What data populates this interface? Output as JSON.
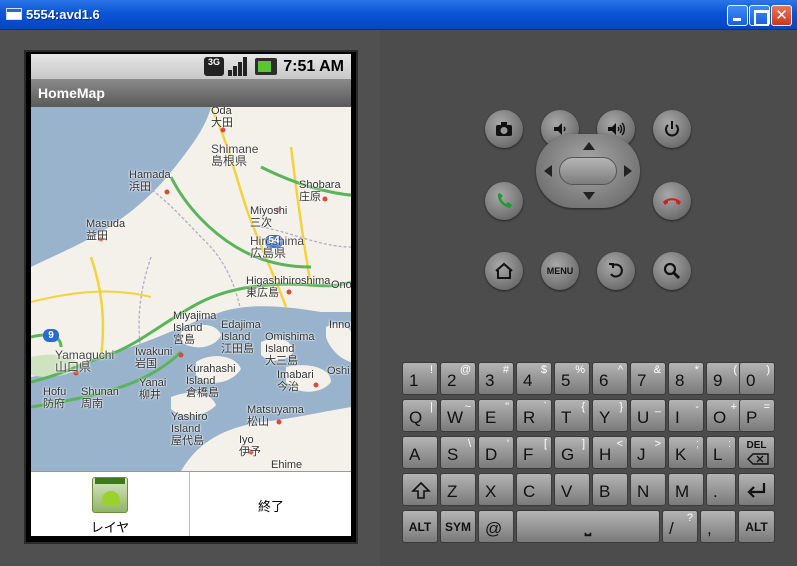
{
  "window": {
    "title": "5554:avd1.6"
  },
  "status": {
    "network": "3G",
    "time": "7:51 AM"
  },
  "app": {
    "title": "HomeMap"
  },
  "map_labels": [
    {
      "text": "Oda",
      "sub": "大田"
    },
    {
      "text": "Shimane",
      "sub": "島根県"
    },
    {
      "text": "Hamada",
      "sub": "浜田"
    },
    {
      "text": "Masuda",
      "sub": "益田"
    },
    {
      "text": "Miyoshi",
      "sub": "三次"
    },
    {
      "text": "Shobara",
      "sub": "庄原"
    },
    {
      "text": "Hiroshima",
      "sub": "広島県"
    },
    {
      "text": "Higashihiroshima",
      "sub": "東広島"
    },
    {
      "text": "Ono",
      "sub": ""
    },
    {
      "text": "Yamaguchi",
      "sub": "山口県"
    },
    {
      "text": "Hofu",
      "sub": "防府"
    },
    {
      "text": "Shunan",
      "sub": "周南"
    },
    {
      "text": "Iwakuni",
      "sub": "岩国"
    },
    {
      "text": "Yanai",
      "sub": "柳井"
    },
    {
      "text": "Miyajima Island",
      "sub": "宮島"
    },
    {
      "text": "Edajima Island",
      "sub": "江田島"
    },
    {
      "text": "Omishima Island",
      "sub": "大三島"
    },
    {
      "text": "Innos",
      "sub": ""
    },
    {
      "text": "Kurahashi Island",
      "sub": "倉橋島"
    },
    {
      "text": "Imabari",
      "sub": "今治"
    },
    {
      "text": "Oshi",
      "sub": ""
    },
    {
      "text": "Yashiro Island",
      "sub": "屋代島"
    },
    {
      "text": "Matsuyama",
      "sub": "松山"
    },
    {
      "text": "Iyo",
      "sub": "伊予"
    },
    {
      "text": "Ehime",
      "sub": ""
    }
  ],
  "route_shields": [
    "54",
    "9"
  ],
  "menu": {
    "layer_label": "レイヤ",
    "quit_label": "終了",
    "icon_badge": "Android"
  },
  "controls": {
    "menu_label": "MENU"
  },
  "keyboard": {
    "row1": [
      {
        "main": "1",
        "alt": "!"
      },
      {
        "main": "2",
        "alt": "@"
      },
      {
        "main": "3",
        "alt": "#"
      },
      {
        "main": "4",
        "alt": "$"
      },
      {
        "main": "5",
        "alt": "%"
      },
      {
        "main": "6",
        "alt": "^"
      },
      {
        "main": "7",
        "alt": "&"
      },
      {
        "main": "8",
        "alt": "*"
      },
      {
        "main": "9",
        "alt": "("
      },
      {
        "main": "0",
        "alt": ")"
      }
    ],
    "row2": [
      {
        "main": "Q",
        "alt": "|"
      },
      {
        "main": "W",
        "alt": "~"
      },
      {
        "main": "E",
        "alt": "\""
      },
      {
        "main": "R",
        "alt": "`"
      },
      {
        "main": "T",
        "alt": "{"
      },
      {
        "main": "Y",
        "alt": "}"
      },
      {
        "main": "U",
        "alt": "_"
      },
      {
        "main": "I",
        "alt": "-"
      },
      {
        "main": "O",
        "alt": "+"
      },
      {
        "main": "P",
        "alt": "="
      }
    ],
    "row3": [
      {
        "main": "A",
        "alt": ""
      },
      {
        "main": "S",
        "alt": "\\"
      },
      {
        "main": "D",
        "alt": "'"
      },
      {
        "main": "F",
        "alt": "["
      },
      {
        "main": "G",
        "alt": "]"
      },
      {
        "main": "H",
        "alt": "<"
      },
      {
        "main": "J",
        "alt": ">"
      },
      {
        "main": "K",
        "alt": ";"
      },
      {
        "main": "L",
        "alt": ":"
      }
    ],
    "del_label": "DEL",
    "row4": [
      {
        "main": "Z",
        "alt": ""
      },
      {
        "main": "X",
        "alt": ""
      },
      {
        "main": "C",
        "alt": ""
      },
      {
        "main": "V",
        "alt": ""
      },
      {
        "main": "B",
        "alt": ""
      },
      {
        "main": "N",
        "alt": ""
      },
      {
        "main": "M",
        "alt": ""
      },
      {
        "main": ".",
        "alt": ""
      }
    ],
    "alt_label": "ALT",
    "sym_label": "SYM",
    "at_label": "@",
    "space_label": "⎵",
    "slash_main": "/",
    "slash_alt": "?",
    "comma_main": ",",
    "comma_alt": ""
  }
}
